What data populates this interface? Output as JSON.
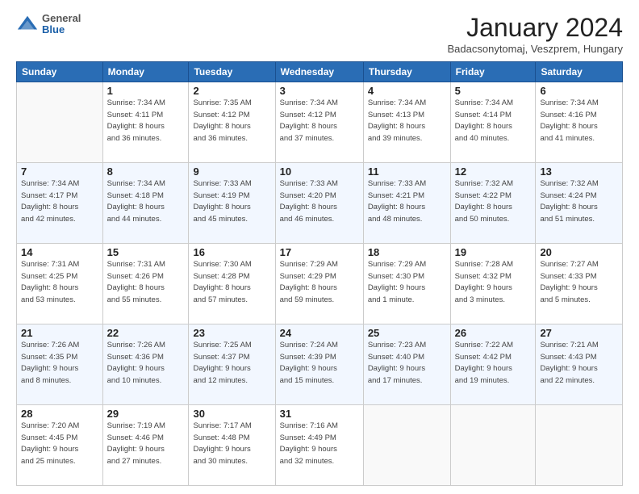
{
  "header": {
    "logo": {
      "general": "General",
      "blue": "Blue"
    },
    "title": "January 2024",
    "location": "Badacsonytomaj, Veszprem, Hungary"
  },
  "days_of_week": [
    "Sunday",
    "Monday",
    "Tuesday",
    "Wednesday",
    "Thursday",
    "Friday",
    "Saturday"
  ],
  "weeks": [
    [
      {
        "day": "",
        "info": ""
      },
      {
        "day": "1",
        "info": "Sunrise: 7:34 AM\nSunset: 4:11 PM\nDaylight: 8 hours\nand 36 minutes."
      },
      {
        "day": "2",
        "info": "Sunrise: 7:35 AM\nSunset: 4:12 PM\nDaylight: 8 hours\nand 36 minutes."
      },
      {
        "day": "3",
        "info": "Sunrise: 7:34 AM\nSunset: 4:12 PM\nDaylight: 8 hours\nand 37 minutes."
      },
      {
        "day": "4",
        "info": "Sunrise: 7:34 AM\nSunset: 4:13 PM\nDaylight: 8 hours\nand 39 minutes."
      },
      {
        "day": "5",
        "info": "Sunrise: 7:34 AM\nSunset: 4:14 PM\nDaylight: 8 hours\nand 40 minutes."
      },
      {
        "day": "6",
        "info": "Sunrise: 7:34 AM\nSunset: 4:16 PM\nDaylight: 8 hours\nand 41 minutes."
      }
    ],
    [
      {
        "day": "7",
        "info": "Sunrise: 7:34 AM\nSunset: 4:17 PM\nDaylight: 8 hours\nand 42 minutes."
      },
      {
        "day": "8",
        "info": "Sunrise: 7:34 AM\nSunset: 4:18 PM\nDaylight: 8 hours\nand 44 minutes."
      },
      {
        "day": "9",
        "info": "Sunrise: 7:33 AM\nSunset: 4:19 PM\nDaylight: 8 hours\nand 45 minutes."
      },
      {
        "day": "10",
        "info": "Sunrise: 7:33 AM\nSunset: 4:20 PM\nDaylight: 8 hours\nand 46 minutes."
      },
      {
        "day": "11",
        "info": "Sunrise: 7:33 AM\nSunset: 4:21 PM\nDaylight: 8 hours\nand 48 minutes."
      },
      {
        "day": "12",
        "info": "Sunrise: 7:32 AM\nSunset: 4:22 PM\nDaylight: 8 hours\nand 50 minutes."
      },
      {
        "day": "13",
        "info": "Sunrise: 7:32 AM\nSunset: 4:24 PM\nDaylight: 8 hours\nand 51 minutes."
      }
    ],
    [
      {
        "day": "14",
        "info": "Sunrise: 7:31 AM\nSunset: 4:25 PM\nDaylight: 8 hours\nand 53 minutes."
      },
      {
        "day": "15",
        "info": "Sunrise: 7:31 AM\nSunset: 4:26 PM\nDaylight: 8 hours\nand 55 minutes."
      },
      {
        "day": "16",
        "info": "Sunrise: 7:30 AM\nSunset: 4:28 PM\nDaylight: 8 hours\nand 57 minutes."
      },
      {
        "day": "17",
        "info": "Sunrise: 7:29 AM\nSunset: 4:29 PM\nDaylight: 8 hours\nand 59 minutes."
      },
      {
        "day": "18",
        "info": "Sunrise: 7:29 AM\nSunset: 4:30 PM\nDaylight: 9 hours\nand 1 minute."
      },
      {
        "day": "19",
        "info": "Sunrise: 7:28 AM\nSunset: 4:32 PM\nDaylight: 9 hours\nand 3 minutes."
      },
      {
        "day": "20",
        "info": "Sunrise: 7:27 AM\nSunset: 4:33 PM\nDaylight: 9 hours\nand 5 minutes."
      }
    ],
    [
      {
        "day": "21",
        "info": "Sunrise: 7:26 AM\nSunset: 4:35 PM\nDaylight: 9 hours\nand 8 minutes."
      },
      {
        "day": "22",
        "info": "Sunrise: 7:26 AM\nSunset: 4:36 PM\nDaylight: 9 hours\nand 10 minutes."
      },
      {
        "day": "23",
        "info": "Sunrise: 7:25 AM\nSunset: 4:37 PM\nDaylight: 9 hours\nand 12 minutes."
      },
      {
        "day": "24",
        "info": "Sunrise: 7:24 AM\nSunset: 4:39 PM\nDaylight: 9 hours\nand 15 minutes."
      },
      {
        "day": "25",
        "info": "Sunrise: 7:23 AM\nSunset: 4:40 PM\nDaylight: 9 hours\nand 17 minutes."
      },
      {
        "day": "26",
        "info": "Sunrise: 7:22 AM\nSunset: 4:42 PM\nDaylight: 9 hours\nand 19 minutes."
      },
      {
        "day": "27",
        "info": "Sunrise: 7:21 AM\nSunset: 4:43 PM\nDaylight: 9 hours\nand 22 minutes."
      }
    ],
    [
      {
        "day": "28",
        "info": "Sunrise: 7:20 AM\nSunset: 4:45 PM\nDaylight: 9 hours\nand 25 minutes."
      },
      {
        "day": "29",
        "info": "Sunrise: 7:19 AM\nSunset: 4:46 PM\nDaylight: 9 hours\nand 27 minutes."
      },
      {
        "day": "30",
        "info": "Sunrise: 7:17 AM\nSunset: 4:48 PM\nDaylight: 9 hours\nand 30 minutes."
      },
      {
        "day": "31",
        "info": "Sunrise: 7:16 AM\nSunset: 4:49 PM\nDaylight: 9 hours\nand 32 minutes."
      },
      {
        "day": "",
        "info": ""
      },
      {
        "day": "",
        "info": ""
      },
      {
        "day": "",
        "info": ""
      }
    ]
  ]
}
